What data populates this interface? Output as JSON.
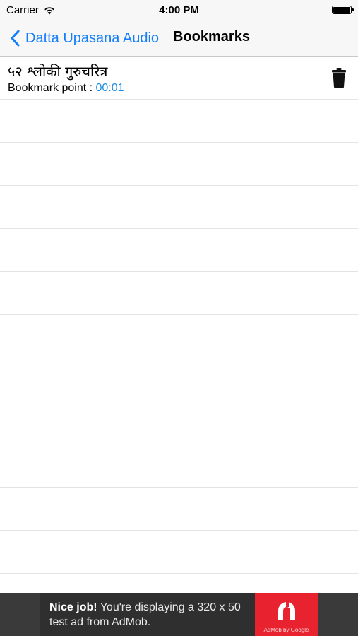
{
  "status_bar": {
    "carrier": "Carrier",
    "time": "4:00 PM",
    "wifi_icon": "wifi-icon",
    "battery_icon": "battery-icon"
  },
  "nav": {
    "back_label": "Datta Upasana Audio",
    "title": "Bookmarks",
    "back_icon": "chevron-left-icon"
  },
  "bookmarks": [
    {
      "title": "५२ श्लोकी गुरुचरित्र",
      "point_label": "Bookmark point : ",
      "point_time": "00:01",
      "delete_icon": "trash-icon"
    }
  ],
  "empty_row_count": 11,
  "ad": {
    "headline": "Nice job!",
    "body": " You're displaying a 320 x 50 test ad from AdMob.",
    "logo_label": "AdMob by Google"
  },
  "colors": {
    "accent": "#147efb",
    "time_text": "#1a8be0",
    "ad_background": "#2f2f2f",
    "ad_logo": "#e8222e"
  }
}
